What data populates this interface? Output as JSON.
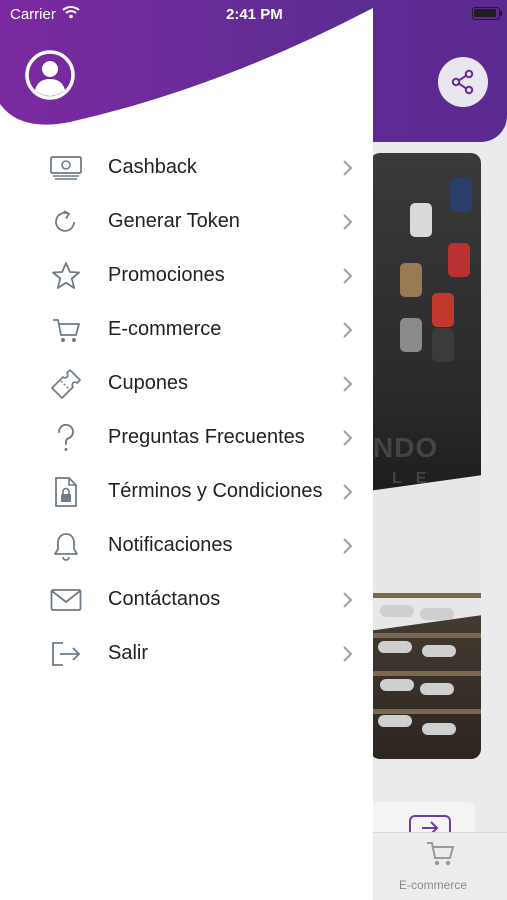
{
  "status_bar": {
    "carrier": "Carrier",
    "time": "2:41 PM"
  },
  "menu": {
    "items": [
      {
        "label": "Cashback",
        "icon": "money-icon"
      },
      {
        "label": "Generar Token",
        "icon": "refresh-icon"
      },
      {
        "label": "Promociones",
        "icon": "star-icon"
      },
      {
        "label": "E-commerce",
        "icon": "cart-icon"
      },
      {
        "label": "Cupones",
        "icon": "ticket-icon"
      },
      {
        "label": "Preguntas Frecuentes",
        "icon": "question-icon"
      },
      {
        "label": "Términos y Condiciones",
        "icon": "document-lock-icon"
      },
      {
        "label": "Notificaciones",
        "icon": "bell-icon"
      },
      {
        "label": "Contáctanos",
        "icon": "mail-icon"
      },
      {
        "label": "Salir",
        "icon": "logout-icon"
      }
    ]
  },
  "background": {
    "banner_text": "NDO",
    "banner_subtext": "LE",
    "tab_label": "E-commerce"
  },
  "colors": {
    "brand_purple": "#6a2aa2",
    "icon_gray": "#6f7b85",
    "text": "#222222"
  }
}
